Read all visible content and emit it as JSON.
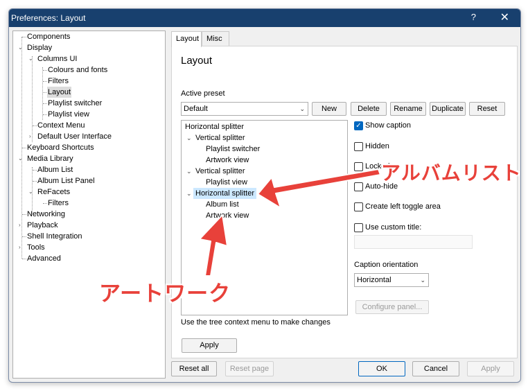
{
  "window": {
    "title": "Preferences: Layout",
    "help_glyph": "?",
    "close_glyph": "✕"
  },
  "nav_tree": [
    {
      "label": "Components"
    },
    {
      "label": "Display"
    },
    {
      "label": "Columns UI"
    },
    {
      "label": "Colours and fonts"
    },
    {
      "label": "Filters"
    },
    {
      "label": "Layout",
      "selected": true
    },
    {
      "label": "Playlist switcher"
    },
    {
      "label": "Playlist view"
    },
    {
      "label": "Context Menu"
    },
    {
      "label": "Default User Interface"
    },
    {
      "label": "Keyboard Shortcuts"
    },
    {
      "label": "Media Library"
    },
    {
      "label": "Album List"
    },
    {
      "label": "Album List Panel"
    },
    {
      "label": "ReFacets"
    },
    {
      "label": "Filters"
    },
    {
      "label": "Networking"
    },
    {
      "label": "Playback"
    },
    {
      "label": "Shell Integration"
    },
    {
      "label": "Tools"
    },
    {
      "label": "Advanced"
    }
  ],
  "tabs": [
    "Layout",
    "Misc"
  ],
  "page": {
    "heading": "Layout",
    "active_preset_label": "Active preset",
    "preset_value": "Default",
    "preset_buttons": [
      "New",
      "Delete",
      "Rename",
      "Duplicate",
      "Reset"
    ],
    "layout_tree": [
      "Horizontal splitter",
      "Vertical splitter",
      "Playlist switcher",
      "Artwork view",
      "Vertical splitter",
      "Playlist view",
      "Horizontal splitter",
      "Album list",
      "Artwork view"
    ],
    "options": {
      "show_caption": "Show caption",
      "hidden": "Hidden",
      "locked": "Locked",
      "autohide": "Auto-hide",
      "create_left_toggle": "Create left toggle area",
      "use_custom_title": "Use custom title:"
    },
    "show_caption_checked": true,
    "caption_orientation_label": "Caption orientation",
    "caption_orientation_value": "Horizontal",
    "configure_panel": "Configure panel...",
    "hint": "Use the tree context menu to make changes",
    "apply": "Apply"
  },
  "footer": {
    "reset_all": "Reset all",
    "reset_page": "Reset page",
    "ok": "OK",
    "cancel": "Cancel",
    "apply": "Apply"
  },
  "annotations": {
    "album_list": "アルバムリスト",
    "artwork": "アートワーク",
    "color": "#e8413a"
  }
}
